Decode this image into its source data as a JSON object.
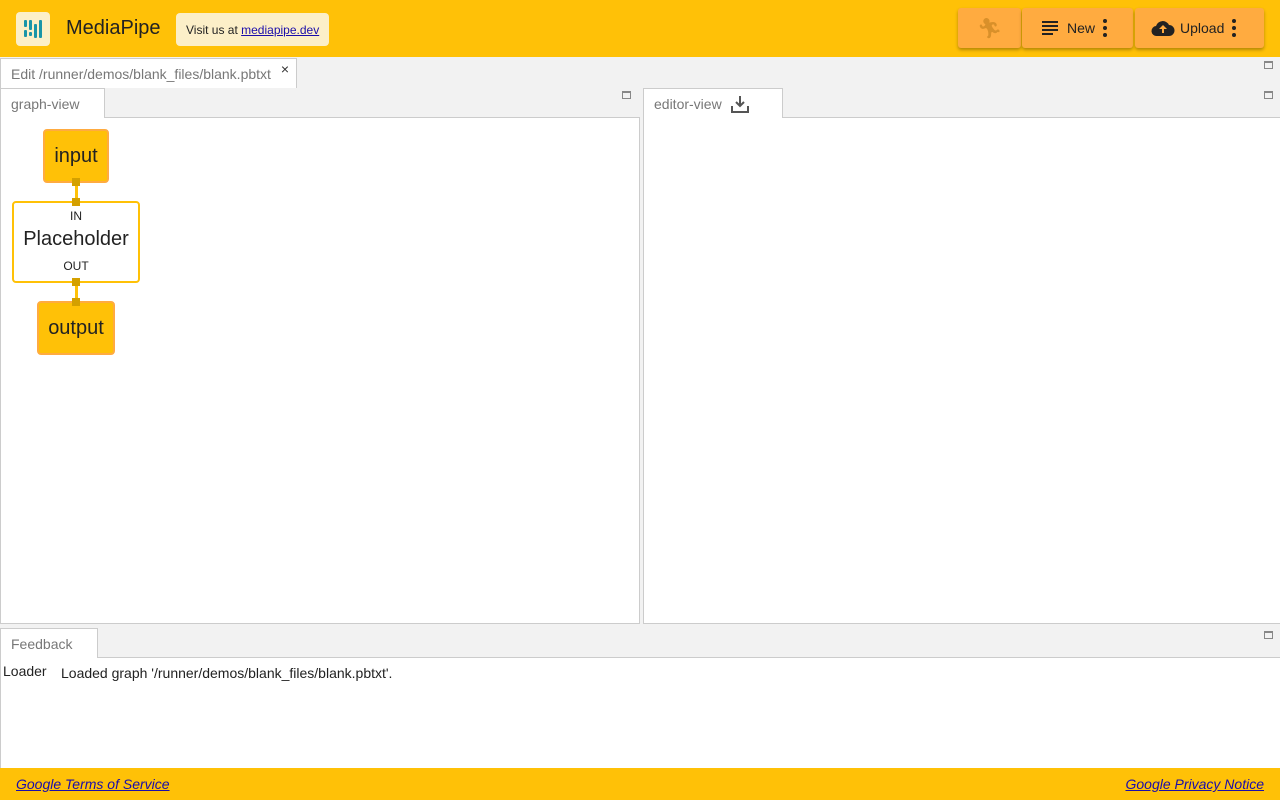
{
  "header": {
    "title": "MediaPipe",
    "visit_prefix": "Visit us at ",
    "visit_link": "mediapipe.dev",
    "new_label": "New",
    "upload_label": "Upload"
  },
  "tabs": {
    "file_tab": "Edit /runner/demos/blank_files/blank.pbtxt",
    "close": "×",
    "graph_view": "graph-view",
    "editor_view": "editor-view",
    "feedback": "Feedback"
  },
  "graph": {
    "input": "input",
    "node_label": "Placeholder",
    "in_port": "IN",
    "out_port": "OUT",
    "output": "output"
  },
  "feedback": {
    "source": "Loader",
    "message": "Loaded graph '/runner/demos/blank_files/blank.pbtxt'."
  },
  "footer": {
    "terms": "Google Terms of Service",
    "privacy": "Google Privacy Notice"
  }
}
